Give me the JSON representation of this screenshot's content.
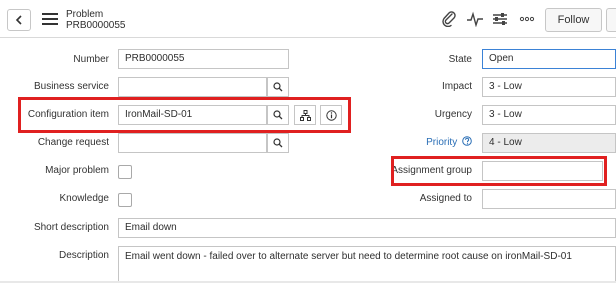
{
  "header": {
    "record_type": "Problem",
    "record_number": "PRB0000055",
    "follow_label": "Follow",
    "icons": [
      "back-icon",
      "menu-icon",
      "attachment-icon",
      "activity-icon",
      "settings-icon",
      "more-icon"
    ]
  },
  "form": {
    "number": {
      "label": "Number",
      "value": "PRB0000055"
    },
    "business_service": {
      "label": "Business service",
      "value": ""
    },
    "configuration_item": {
      "label": "Configuration item",
      "value": "IronMail-SD-01"
    },
    "change_request": {
      "label": "Change request",
      "value": ""
    },
    "major_problem": {
      "label": "Major problem",
      "checked": false
    },
    "knowledge": {
      "label": "Knowledge",
      "checked": false
    },
    "short_description": {
      "label": "Short description",
      "value": "Email down"
    },
    "description": {
      "label": "Description",
      "value": "Email went down - failed over to alternate server but need to determine root cause on ironMail-SD-01"
    },
    "state": {
      "label": "State",
      "value": "Open"
    },
    "impact": {
      "label": "Impact",
      "value": "3 - Low"
    },
    "urgency": {
      "label": "Urgency",
      "value": "3 - Low"
    },
    "priority": {
      "label": "Priority",
      "value": "4 - Low"
    },
    "assignment_group": {
      "label": "Assignment group",
      "value": ""
    },
    "assigned_to": {
      "label": "Assigned to",
      "value": ""
    }
  },
  "colors": {
    "highlight": "#e02020",
    "priority_link": "#2b6fb6",
    "readonly_bg": "#ececec"
  }
}
